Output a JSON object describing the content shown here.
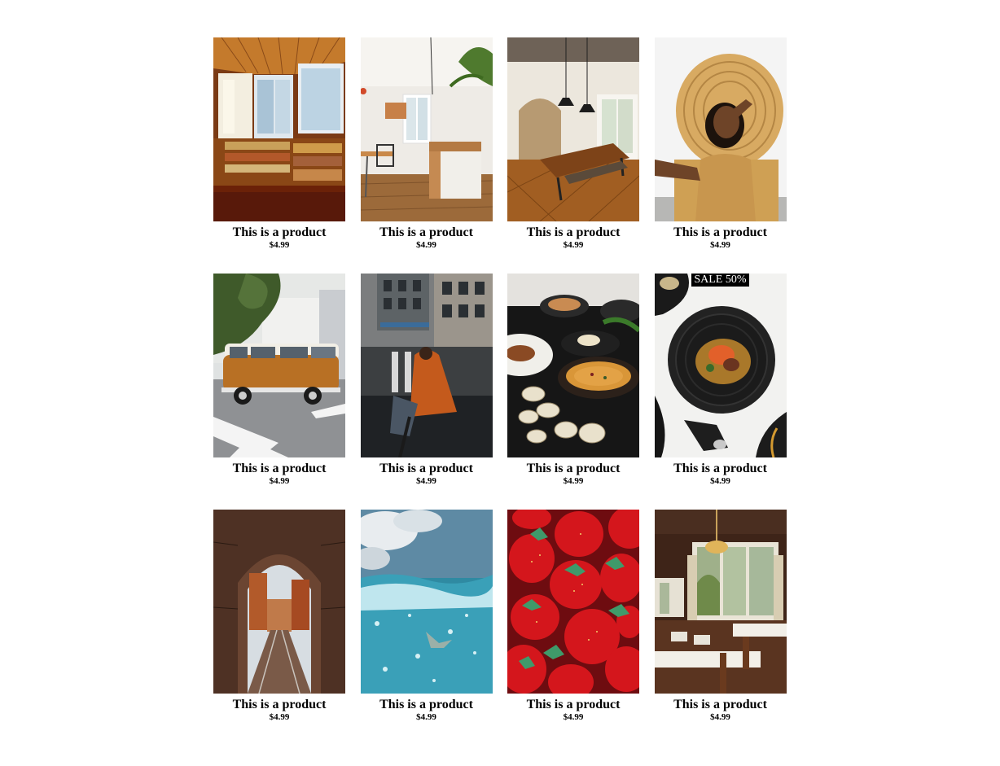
{
  "products": [
    {
      "title": "This is a product",
      "price": "$4.99",
      "image": "reading-nook-photo"
    },
    {
      "title": "This is a product",
      "price": "$4.99",
      "image": "kitchen-interior-photo"
    },
    {
      "title": "This is a product",
      "price": "$4.99",
      "image": "dining-room-photo"
    },
    {
      "title": "This is a product",
      "price": "$4.99",
      "image": "woman-wicker-chair-photo"
    },
    {
      "title": "This is a product",
      "price": "$4.99",
      "image": "vintage-van-photo"
    },
    {
      "title": "This is a product",
      "price": "$4.99",
      "image": "street-person-photo"
    },
    {
      "title": "This is a product",
      "price": "$4.99",
      "image": "food-spread-photo"
    },
    {
      "title": "This is a product",
      "price": "$4.99",
      "image": "plated-dish-photo",
      "badge": "SALE 50%"
    },
    {
      "title": "This is a product",
      "price": "$4.99",
      "image": "archway-street-photo"
    },
    {
      "title": "This is a product",
      "price": "$4.99",
      "image": "ocean-underwater-photo"
    },
    {
      "title": "This is a product",
      "price": "$4.99",
      "image": "strawberries-photo"
    },
    {
      "title": "This is a product",
      "price": "$4.99",
      "image": "restaurant-interior-photo"
    }
  ],
  "colors": {
    "background": "#ffffff",
    "text": "#000000",
    "badge_bg": "#000000",
    "badge_text": "#ffffff"
  }
}
